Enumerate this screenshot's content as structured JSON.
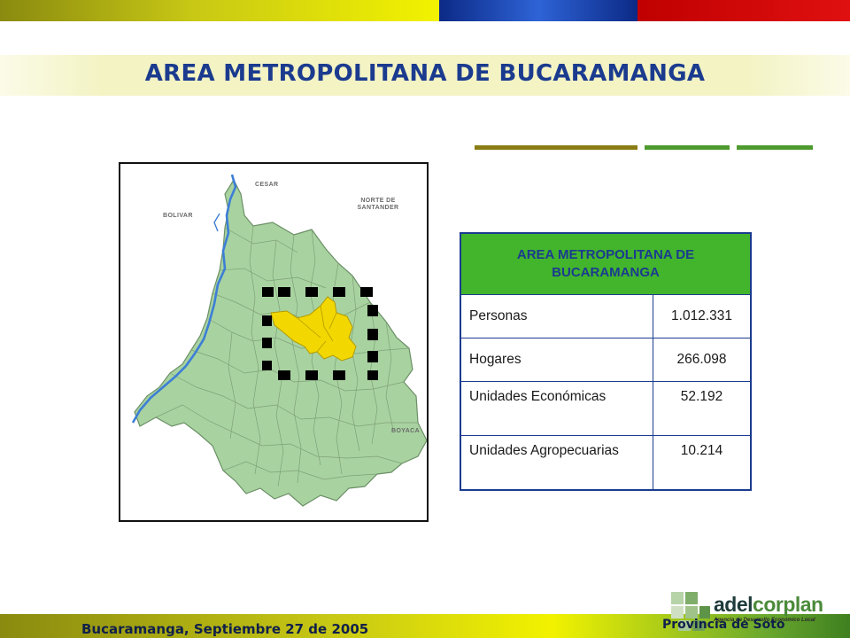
{
  "header": {
    "title": "AREA METROPOLITANA DE BUCARAMANGA"
  },
  "map": {
    "labels": {
      "cesar": "CESAR",
      "bolivar": "BOLIVAR",
      "norte_santander": "NORTE DE SANTANDER",
      "boyaca": "BOYACA"
    },
    "region_color": "#a8d3a0",
    "highlight_color": "#f2d800",
    "river_color": "#3d7ed6"
  },
  "table": {
    "header": "AREA METROPOLITANA DE BUCARAMANGA",
    "rows": [
      {
        "label": "Personas",
        "value": "1.012.331"
      },
      {
        "label": "Hogares",
        "value": "266.098"
      },
      {
        "label": "Unidades Económicas",
        "value": "52.192"
      },
      {
        "label": "Unidades Agropecuarias",
        "value": "10.214"
      }
    ],
    "header_color": "#43b52c",
    "border_color": "#1b3b8f"
  },
  "footer": {
    "date": "Bucaramanga, Septiembre 27 de 2005",
    "province": "Provincia de Soto"
  },
  "logo": {
    "text_a": "adel",
    "text_b": "corplan",
    "subtitle": "Agencia de Desarrollo Económico Local"
  }
}
